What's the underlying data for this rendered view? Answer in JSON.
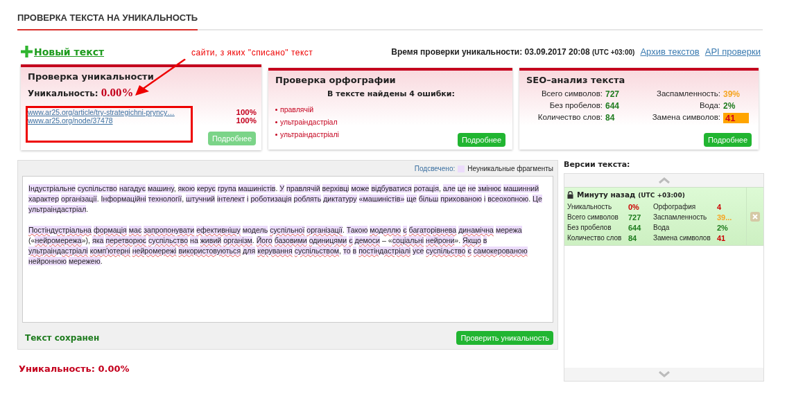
{
  "header": {
    "title": "ПРОВЕРКА ТЕКСТА НА УНИКАЛЬНОСТЬ"
  },
  "toolbar": {
    "new_text": "Новый текст",
    "check_time_label": "Время проверки уникальности:",
    "check_time": "03.09.2017 20:08",
    "timezone": "(UTC +03:00)",
    "links": [
      "Архив текстов",
      "API проверки"
    ]
  },
  "annotation": "сайти, з яких \"списано\" текст",
  "uniqueness_card": {
    "title": "Проверка уникальности",
    "label": "Уникальность:",
    "value": "0.00%",
    "sources": [
      {
        "url": "www.ar25.org/article/try-strategichni-pryncy…",
        "percent": "100%"
      },
      {
        "url": "www.ar25.org/node/37478",
        "percent": "100%"
      }
    ],
    "button": {
      "label": "Подробнее",
      "disabled": true
    }
  },
  "spelling_card": {
    "title": "Проверка орфографии",
    "summary": "В тексте найдены 4 ошибки:",
    "errors": [
      "правлячій",
      "ультраіндастріал",
      "ультраіндастріалі"
    ],
    "button": {
      "label": "Подробнее",
      "disabled": false
    }
  },
  "seo_card": {
    "title": "SEO–анализ текста",
    "stats": [
      {
        "label": "Всего символов:",
        "value": "727",
        "color": "#1e7b1e",
        "highlighted": false
      },
      {
        "label": "Заспамленность:",
        "value": "39%",
        "color": "#f5a623",
        "highlighted": false
      },
      {
        "label": "Без пробелов:",
        "value": "644",
        "color": "#1e7b1e",
        "highlighted": false
      },
      {
        "label": "Вода:",
        "value": "2%",
        "color": "#1e7b1e",
        "highlighted": false
      },
      {
        "label": "Количество слов:",
        "value": "84",
        "color": "#1e7b1e",
        "highlighted": false
      },
      {
        "label": "Замена символов:",
        "value": "41",
        "highlighted": true
      }
    ],
    "button": {
      "label": "Подробнее",
      "disabled": false
    }
  },
  "editor": {
    "legend_label": "Подсвечено:",
    "legend_text": "Неуникальные фрагменты",
    "paragraphs": [
      {
        "segments": [
          {
            "text": "Індустріальне суспільство нагадує машину",
            "kind": "match"
          },
          {
            "text": ", ",
            "kind": "plain"
          },
          {
            "text": "якою керує група машиністів",
            "kind": "match"
          },
          {
            "text": ". ",
            "kind": "plain"
          },
          {
            "text": "У правлячій верхівці може відбуватися ротація",
            "kind": "match"
          },
          {
            "text": ", ",
            "kind": "plain"
          },
          {
            "text": "але це не змінює машинний характер організації",
            "kind": "match"
          },
          {
            "text": ". ",
            "kind": "plain"
          },
          {
            "text": "Інформаційні технології",
            "kind": "match"
          },
          {
            "text": ", ",
            "kind": "plain"
          },
          {
            "text": "штучний інтелект і роботизація роблять диктатуру «машиністів» ще більш прихованою і всеохопною",
            "kind": "match"
          },
          {
            "text": ". ",
            "kind": "plain"
          },
          {
            "text": "Це ультраіндастріал",
            "kind": "match"
          },
          {
            "text": ".",
            "kind": "plain"
          }
        ]
      },
      {
        "segments": [
          {
            "text": "Постіндустріальна формація має запропонувати ефективнішу",
            "kind": "spell"
          },
          {
            "text": "модель",
            "kind": "match"
          },
          {
            "text": "суспільної організації",
            "kind": "spell"
          },
          {
            "text": ". ",
            "kind": "plain"
          },
          {
            "text": "Такою",
            "kind": "match"
          },
          {
            "text": "моделлю є багаторівнева динамічна",
            "kind": "spell"
          },
          {
            "text": "мережа",
            "kind": "match"
          },
          {
            "text": " («",
            "kind": "plain"
          },
          {
            "text": "нейромережа",
            "kind": "spell"
          },
          {
            "text": "»), ",
            "kind": "plain"
          },
          {
            "text": "яка",
            "kind": "match"
          },
          {
            "text": "перетворює суспільство",
            "kind": "spell"
          },
          {
            "text": "на",
            "kind": "match"
          },
          {
            "text": "живий організм",
            "kind": "spell"
          },
          {
            "text": ". ",
            "kind": "plain"
          },
          {
            "text": "Його базовими одиницями є демоси",
            "kind": "spell"
          },
          {
            "text": " – «",
            "kind": "plain"
          },
          {
            "text": "соціальні нейрони",
            "kind": "spell"
          },
          {
            "text": "». ",
            "kind": "plain"
          },
          {
            "text": "Якщо",
            "kind": "spell"
          },
          {
            "text": "в",
            "kind": "match"
          },
          {
            "text": "ультраіндастріалі комп'ютерні нейромережі використовуються",
            "kind": "spell"
          },
          {
            "text": "для",
            "kind": "match"
          },
          {
            "text": "керування суспільством",
            "kind": "spell"
          },
          {
            "text": ", ",
            "kind": "plain"
          },
          {
            "text": "то в",
            "kind": "match"
          },
          {
            "text": "постіндастріалі",
            "kind": "spell"
          },
          {
            "text": "усе",
            "kind": "match"
          },
          {
            "text": "суспільство є самокерованою",
            "kind": "spell"
          },
          {
            "text": "нейронною мережею",
            "kind": "match"
          },
          {
            "text": ".",
            "kind": "plain"
          }
        ]
      }
    ],
    "status": "Текст сохранен",
    "check_button": "Проверить уникальность"
  },
  "result": {
    "label": "Уникальность: 0.00%"
  },
  "versions": {
    "title": "Версии текста:",
    "items": [
      {
        "time": "Минуту назад",
        "timezone": "(UTC +03:00)",
        "locked": true,
        "stats": [
          {
            "label": "Уникальность",
            "value": "0%",
            "color": "#cc0000"
          },
          {
            "label": "Орфография",
            "value": "4",
            "color": "#cc0000"
          },
          {
            "label": "Всего символов",
            "value": "727",
            "color": "#1e7b1e"
          },
          {
            "label": "Заспамленность",
            "value": "39...",
            "color": "#f5a623"
          },
          {
            "label": "Без пробелов",
            "value": "644",
            "color": "#1e7b1e"
          },
          {
            "label": "Вода",
            "value": "2%",
            "color": "#1e7b1e"
          },
          {
            "label": "Количество слов",
            "value": "84",
            "color": "#1e7b1e"
          },
          {
            "label": "Замена символов",
            "value": "41",
            "color": "#cc0000"
          }
        ]
      }
    ]
  }
}
